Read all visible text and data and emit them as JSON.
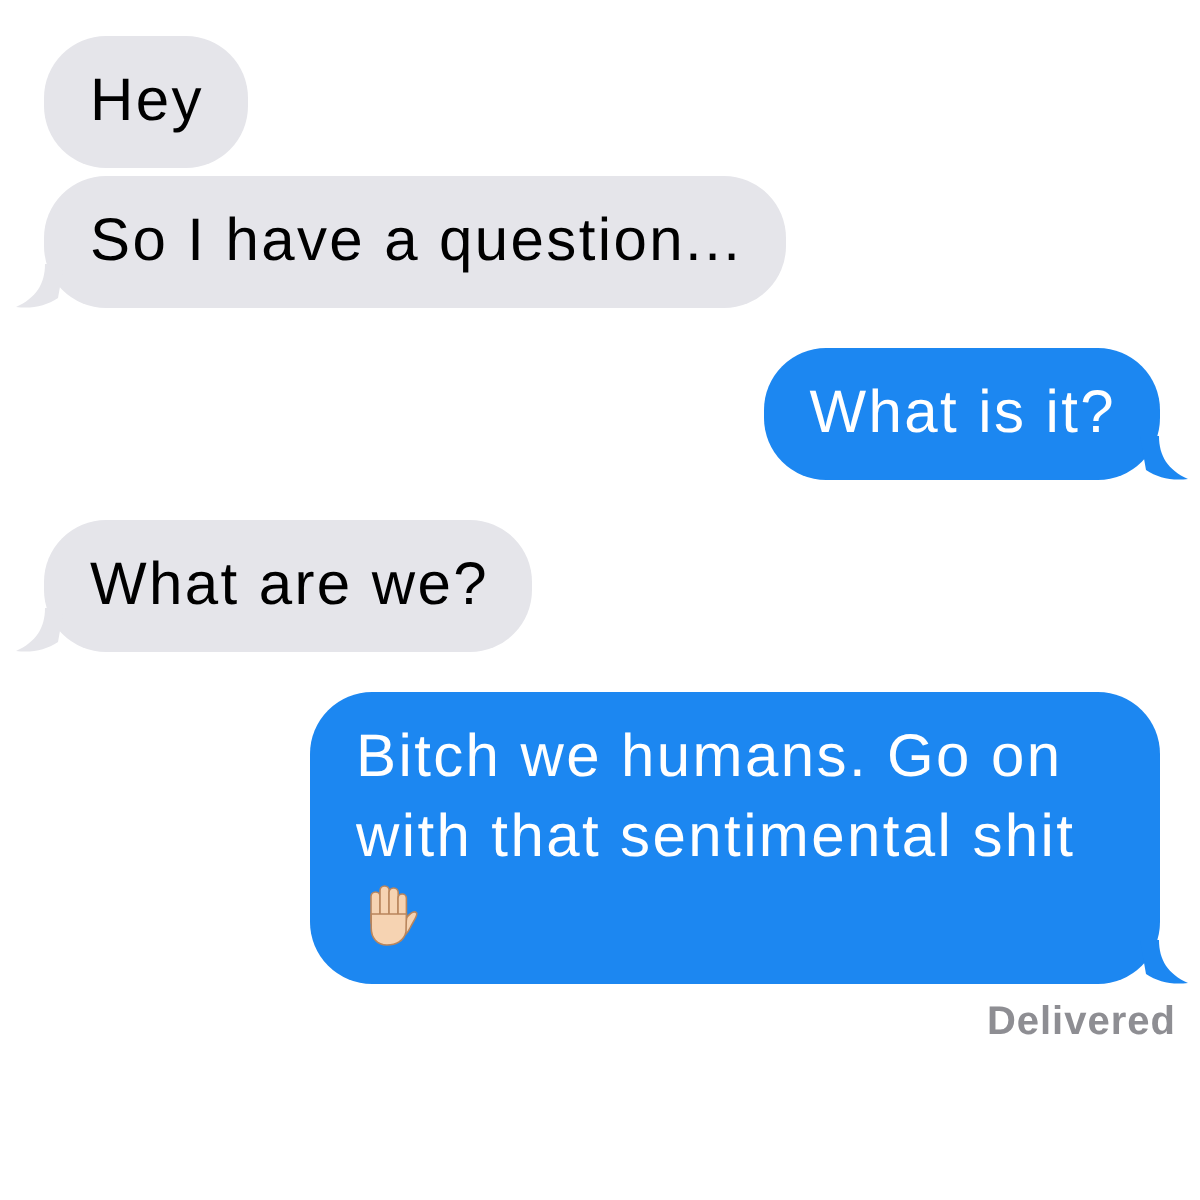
{
  "messages": [
    {
      "kind": "received",
      "text": "Hey",
      "tail": false
    },
    {
      "kind": "received",
      "text": "So I have a question...",
      "tail": true
    },
    {
      "kind": "sent",
      "text": "What is it?",
      "tail": true
    },
    {
      "kind": "received",
      "text": "What are we?",
      "tail": true
    },
    {
      "kind": "sent",
      "text": "Bitch we humans. Go on with that sentimental shit",
      "tail": true,
      "emoji": [
        {
          "kind": "raised-hand"
        }
      ]
    }
  ],
  "delivery_status": "Delivered"
}
